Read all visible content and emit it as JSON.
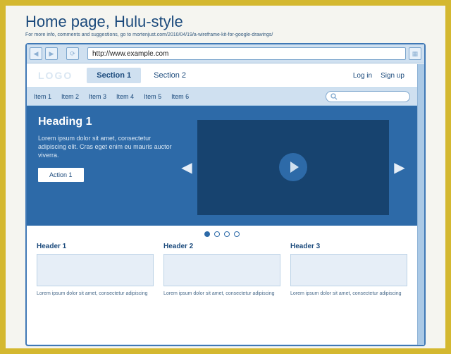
{
  "title": "Home page, Hulu-style",
  "subtitle": "For more info, comments and suggestions, go to mortenjust.com/2010/04/19/a-wireframe-kit-for-google-drawings/",
  "browser": {
    "url": "http://www.example.com"
  },
  "logo": "LOGO",
  "sections": [
    {
      "label": "Section 1",
      "active": true
    },
    {
      "label": "Section 2",
      "active": false
    }
  ],
  "auth": {
    "login": "Log in",
    "signup": "Sign up"
  },
  "nav_items": [
    "Item 1",
    "Item 2",
    "Item 3",
    "Item 4",
    "Item 5",
    "Item 6"
  ],
  "hero": {
    "heading": "Heading 1",
    "body": "Lorem ipsum dolor sit amet, consectetur adipiscing elit. Cras eget enim eu mauris auctor viverra.",
    "action": "Action 1"
  },
  "pagination": {
    "count": 4,
    "index": 0
  },
  "cards": [
    {
      "header": "Header 1",
      "body": "Lorem ipsum dolor sit amet, consectetur adipiscing"
    },
    {
      "header": "Header 2",
      "body": "Lorem ipsum dolor sit amet, consectetur adipiscing"
    },
    {
      "header": "Header 3",
      "body": "Lorem ipsum dolor sit amet, consectetur adipiscing"
    }
  ]
}
